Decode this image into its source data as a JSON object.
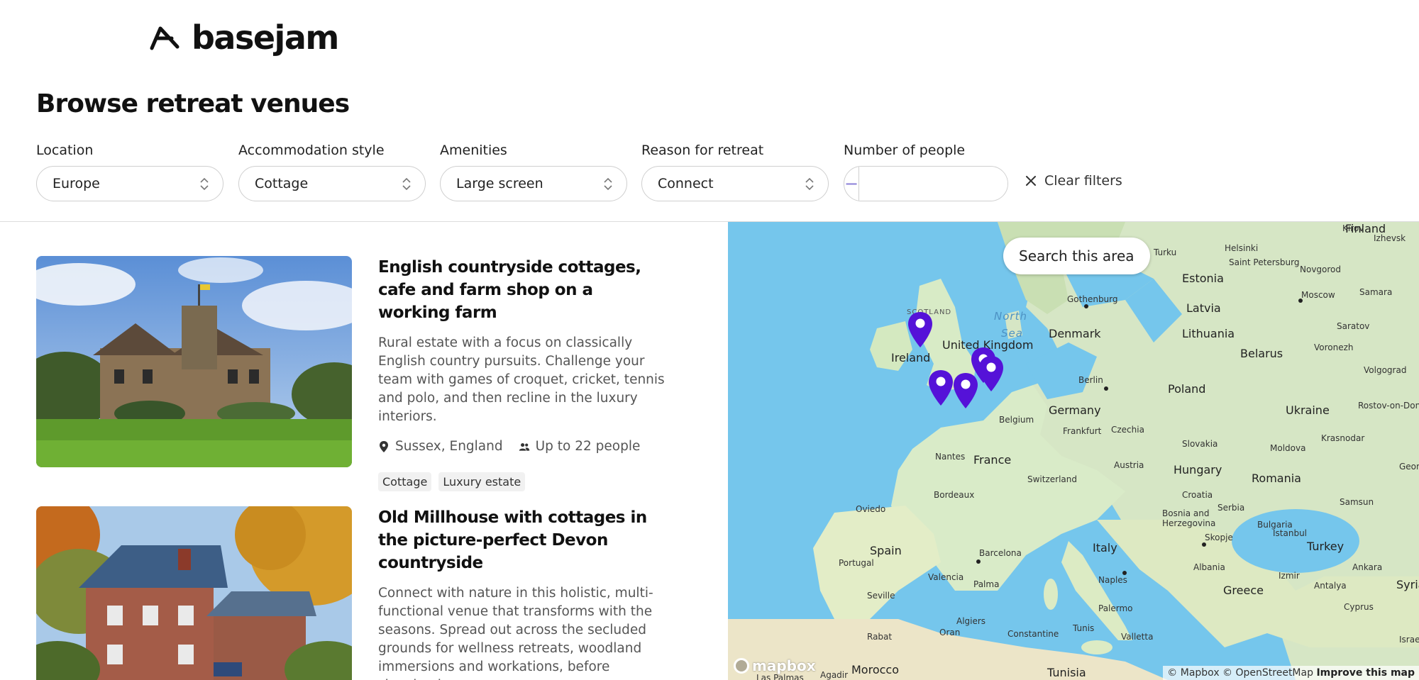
{
  "brand": {
    "name": "basejam"
  },
  "page": {
    "title": "Browse retreat venues"
  },
  "filters": [
    {
      "label": "Location",
      "value": "Europe"
    },
    {
      "label": "Accommodation style",
      "value": "Cottage"
    },
    {
      "label": "Amenities",
      "value": "Large screen"
    },
    {
      "label": "Reason for retreat",
      "value": "Connect"
    }
  ],
  "people": {
    "label": "Number of people",
    "minus": "−",
    "plus": "+",
    "value": ""
  },
  "clear_filters": "Clear filters",
  "listings": [
    {
      "title": "English countryside cottages, cafe and farm shop on a working farm",
      "description": "Rural estate with a focus on classically English country pursuits. Challenge your team with games of croquet, cricket, tennis and polo, and then recline in the luxury interiors.",
      "location": "Sussex, England",
      "capacity": "Up to 22 people",
      "tags": [
        "Cottage",
        "Luxury estate"
      ]
    },
    {
      "title": "Old Millhouse with cottages in the picture-perfect Devon countryside",
      "description": "Connect with nature in this holistic, multi-functional venue that transforms with the seasons. Spread out across the secluded grounds for wellness retreats, woodland immersions and workations, before sleeping in"
    }
  ],
  "map": {
    "search_button": "Search this area",
    "attribution": "© Mapbox © OpenStreetMap",
    "improve": "Improve this map",
    "logo": "mapbox",
    "pin_color": "#5512d8",
    "labels": {
      "countries": [
        "Finland",
        "Estonia",
        "Latvia",
        "Lithuania",
        "Belarus",
        "Denmark",
        "United Kingdom",
        "Ireland",
        "Poland",
        "Ukraine",
        "Germany",
        "Czechia",
        "Belgium",
        "France",
        "Austria",
        "Hungary",
        "Romania",
        "Moldova",
        "Switzerland",
        "Slovakia",
        "Croatia",
        "Serbia",
        "Bosnia and Herzegovina",
        "Bulgaria",
        "Spain",
        "Portugal",
        "Italy",
        "Albania",
        "Greece",
        "Turkey",
        "Syria",
        "Cyprus",
        "Israel",
        "Tunisia",
        "Morocco"
      ],
      "cities": [
        "Turku",
        "Helsinki",
        "Kirov",
        "Izhevsk",
        "Saint Petersburg",
        "Novgorod",
        "Moscow",
        "Samara",
        "Saratov",
        "Voronezh",
        "Volgograd",
        "Rostov-on-Don",
        "Krasnodar",
        "Gothenburg",
        "Berlin",
        "Frankfurt",
        "Nantes",
        "Bordeaux",
        "Oviedo",
        "Barcelona",
        "Valencia",
        "Palma",
        "Seville",
        "Naples",
        "Palermo",
        "Skopje",
        "Istanbul",
        "Izmir",
        "Antalya",
        "Ankara",
        "Samsun",
        "Algiers",
        "Constantine",
        "Tunis",
        "Valletta",
        "Oran",
        "Rabat",
        "Agadir",
        "Las Palmas",
        "Georg"
      ],
      "seas": [
        "North",
        "Sea"
      ],
      "regions": [
        "SCOTLAND"
      ]
    }
  }
}
